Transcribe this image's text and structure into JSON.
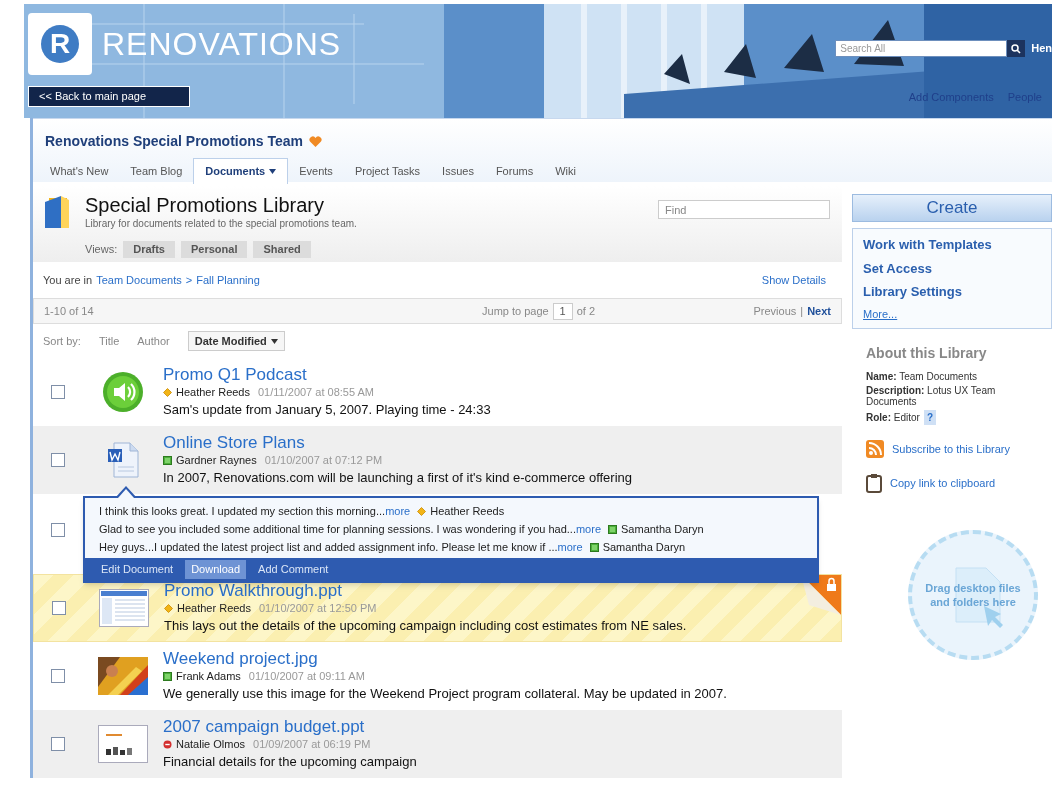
{
  "header": {
    "logo_letter": "R",
    "brand": "RENOVATIONS",
    "back_button": "<< Back to main page",
    "search": {
      "placeholder": "Search All"
    },
    "user": "Hen",
    "links": [
      "Add Components",
      "People"
    ]
  },
  "team": {
    "title": "Renovations Special Promotions Team",
    "tabs": [
      {
        "label": "What's New",
        "selected": false,
        "menu": false
      },
      {
        "label": "Team Blog",
        "selected": false,
        "menu": false
      },
      {
        "label": "Documents",
        "selected": true,
        "menu": true
      },
      {
        "label": "Events",
        "selected": false,
        "menu": false
      },
      {
        "label": "Project Tasks",
        "selected": false,
        "menu": false
      },
      {
        "label": "Issues",
        "selected": false,
        "menu": false
      },
      {
        "label": "Forums",
        "selected": false,
        "menu": false
      },
      {
        "label": "Wiki",
        "selected": false,
        "menu": false
      }
    ]
  },
  "library": {
    "title": "Special Promotions Library",
    "subtitle": "Library for documents related to the special promotions team.",
    "find": {
      "placeholder": "Find"
    },
    "views_label": "Views:",
    "views": [
      "Drafts",
      "Personal",
      "Shared"
    ]
  },
  "breadcrumb": {
    "prefix": "You are in",
    "items": [
      "Team Documents",
      "Fall Planning"
    ],
    "separator": ">",
    "show_details": "Show Details"
  },
  "pagination": {
    "range": "1-10 of 14",
    "jump_label": "Jump to page",
    "page": "1",
    "of": "of 2",
    "previous": "Previous",
    "separator": "|",
    "next": "Next"
  },
  "sort": {
    "label": "Sort by:",
    "options": [
      {
        "label": "Title",
        "selected": false
      },
      {
        "label": "Author",
        "selected": false
      },
      {
        "label": "Date Modified",
        "selected": true
      }
    ]
  },
  "documents": [
    {
      "kind": "audio",
      "checked": false,
      "shaded": false,
      "locked": false,
      "title": "Promo Q1 Podcast",
      "author": {
        "name": "Heather Reeds",
        "kind": "away"
      },
      "date": "01/11/2007 at 08:55 AM",
      "description": "Sam's update from January 5, 2007. Playing time - 24:33"
    },
    {
      "kind": "document",
      "checked": false,
      "shaded": true,
      "locked": false,
      "title": "Online Store Plans",
      "author": {
        "name": "Gardner Raynes",
        "kind": "available"
      },
      "date": "01/10/2007 at 07:12 PM",
      "description": "In 2007, Renovations.com will be launching a first of it's kind e-commerce offering",
      "popup": {
        "comments": [
          {
            "text": "I think this looks great. I updated my section this morning...",
            "more": "more",
            "author": {
              "name": "Heather Reeds",
              "kind": "away"
            }
          },
          {
            "text": "Glad to see you included some additional time for planning sessions. I was wondering if you had...",
            "more": "more",
            "author": {
              "name": "Samantha Daryn",
              "kind": "available"
            }
          },
          {
            "text": "Hey guys...I updated the latest project list and added assignment info. Please let me know if ...",
            "more": "more",
            "author": {
              "name": "Samantha Daryn",
              "kind": "available"
            }
          }
        ],
        "actions": [
          {
            "label": "Edit Document",
            "selected": false
          },
          {
            "label": "Download",
            "selected": true
          },
          {
            "label": "Add Comment",
            "selected": false
          }
        ]
      }
    },
    {
      "kind": "covered",
      "checked": false,
      "shaded": false,
      "locked": false
    },
    {
      "kind": "screenshot",
      "checked": false,
      "shaded": false,
      "locked": true,
      "title": "Promo Walkthrough.ppt",
      "author": {
        "name": "Heather Reeds",
        "kind": "away"
      },
      "date": "01/10/2007 at 12:50 PM",
      "description": "This lays out the details of the upcoming campaign including cost estimates from NE sales."
    },
    {
      "checked": false,
      "shaded": false,
      "locked": false,
      "title": "Weekend project.jpg",
      "author": {
        "name": "Frank Adams",
        "kind": "available"
      },
      "date": "01/10/2007 at 09:11 AM",
      "description": "We generally use this image for the Weekend Project program collateral. May be updated in 2007."
    },
    {
      "kind": "slides",
      "checked": false,
      "shaded": true,
      "locked": false,
      "title": "2007 campaign budget.ppt",
      "author": {
        "name": "Natalie Olmos",
        "kind": "busy"
      },
      "date": "01/09/2007 at 06:19 PM",
      "description": "Financial details for the upcoming campaign"
    }
  ],
  "sidebar": {
    "create": "Create",
    "links": [
      "Work with Templates",
      "Set Access",
      "Library Settings"
    ],
    "more": "More...",
    "about_title": "About this Library",
    "about": [
      "**Name:** Team Documents",
      "**Description:** Lotus UX Team Documents",
      "**Role:** Editor"
    ],
    "help": "?",
    "subscribe": "Subscribe to this Library",
    "copy_link": "Copy link to clipboard",
    "dropzone": "Drag desktop files and folders here"
  }
}
